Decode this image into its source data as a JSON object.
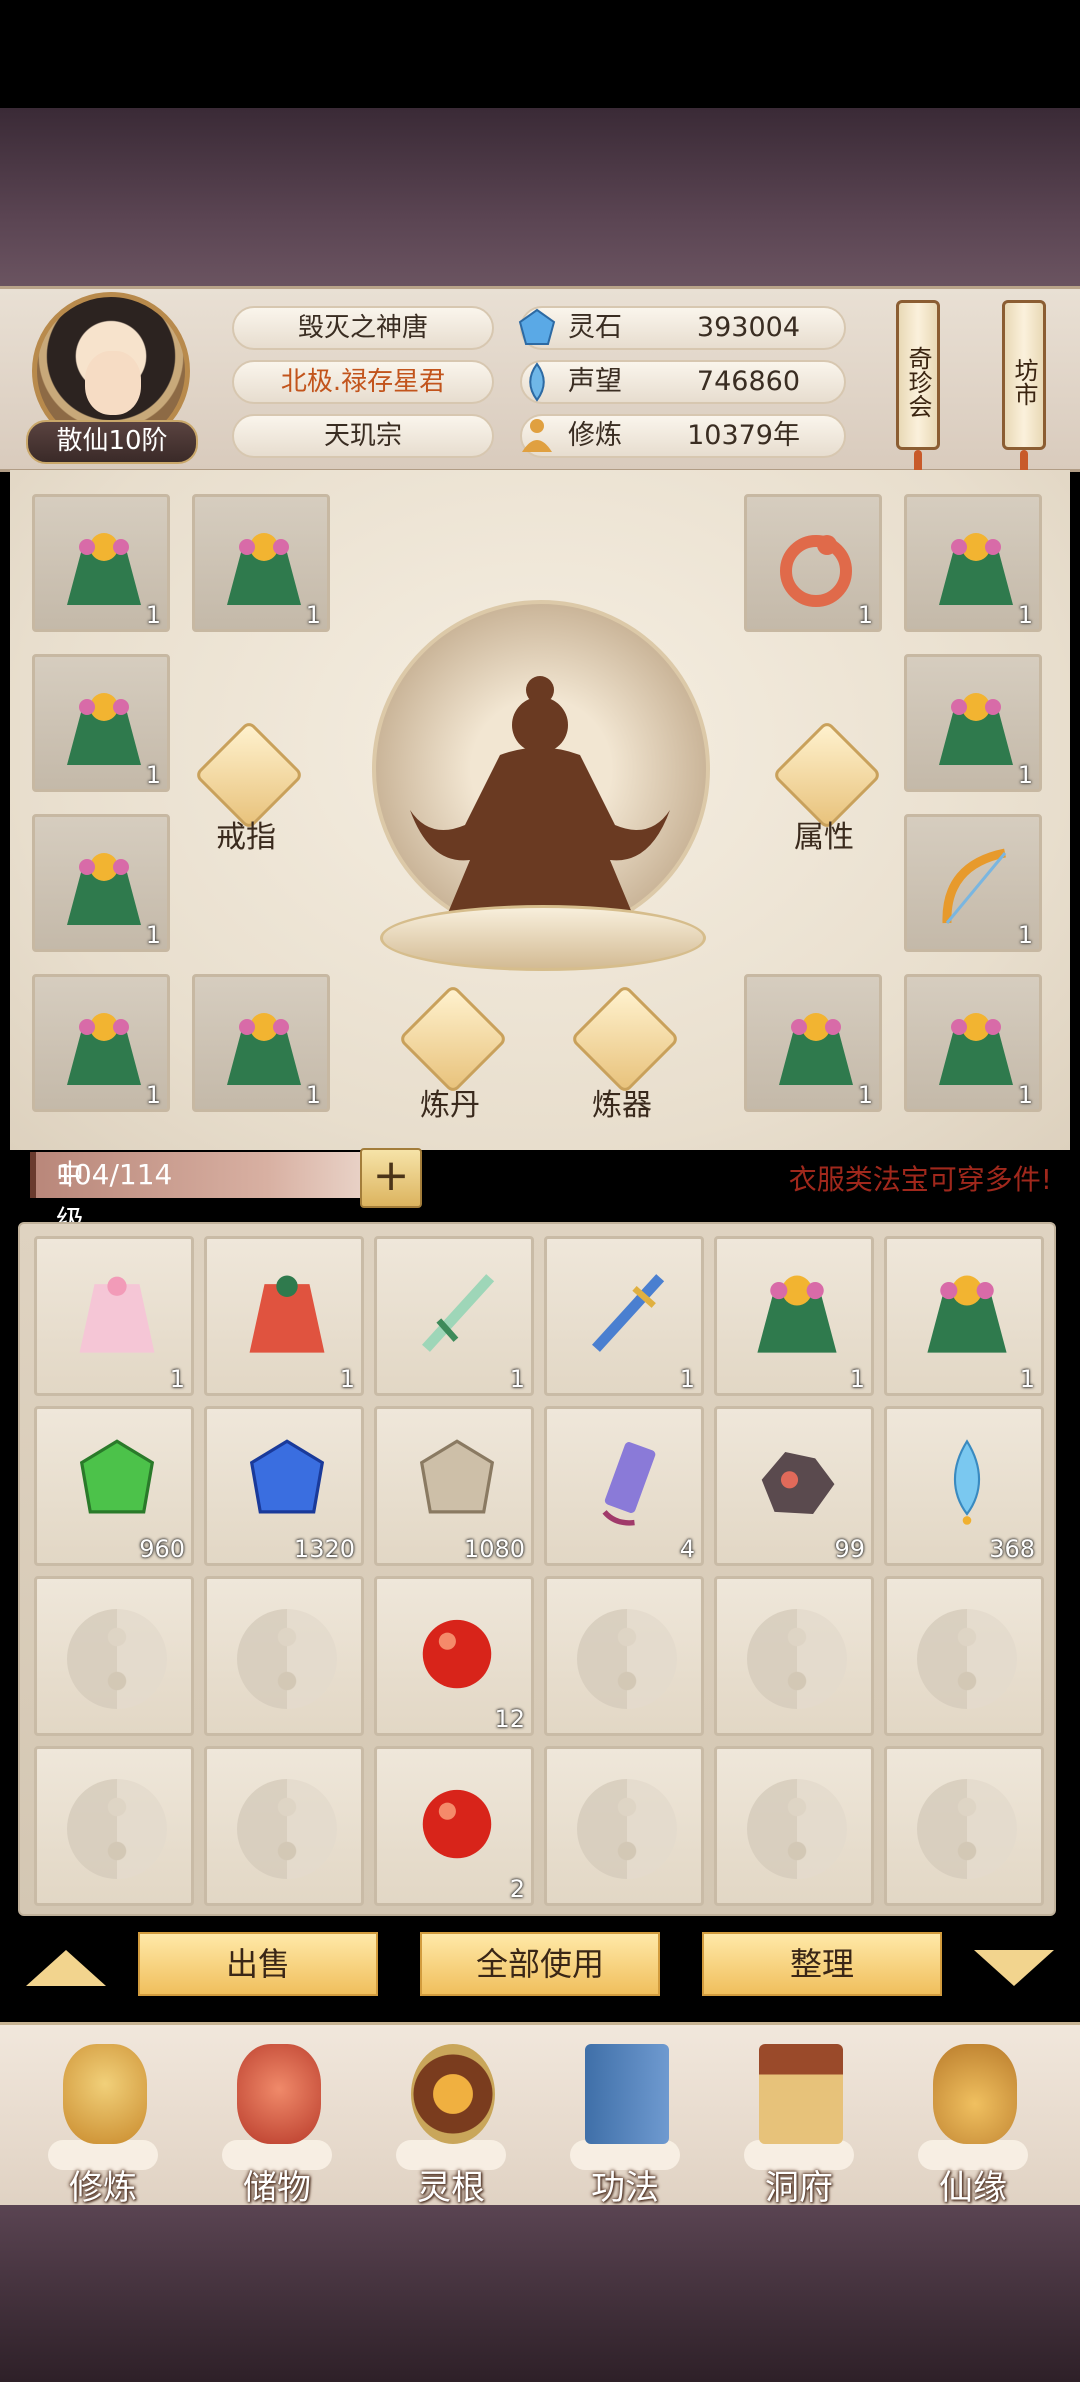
{
  "player": {
    "rank": "散仙10阶",
    "name": "毁灭之神唐",
    "title": "北极.禄存星君",
    "sect": "天玑宗"
  },
  "resources": [
    {
      "label": "灵石",
      "value": "393004",
      "icon": "spirit-stone-icon"
    },
    {
      "label": "声望",
      "value": "746860",
      "icon": "reputation-icon"
    },
    {
      "label": "修炼",
      "value": "10379年",
      "icon": "meditation-icon"
    }
  ],
  "side_buttons": {
    "treasure": "奇珍会",
    "market": "坊市"
  },
  "equip": {
    "left_slots": [
      {
        "item": "green-robe",
        "count": "1"
      },
      {
        "item": "green-robe",
        "count": "1"
      },
      {
        "item": "green-robe",
        "count": "1"
      },
      {
        "item": "green-robe",
        "count": "1"
      },
      {
        "item": "green-robe",
        "count": "1"
      },
      {
        "item": "green-robe",
        "count": "1"
      }
    ],
    "right_slots": [
      {
        "item": "dragon-ring",
        "count": "1"
      },
      {
        "item": "green-robe",
        "count": "1"
      },
      {
        "item": "green-robe",
        "count": "1"
      },
      {
        "item": "bow",
        "count": "1"
      },
      {
        "item": "green-robe",
        "count": "1"
      },
      {
        "item": "green-robe",
        "count": "1"
      }
    ],
    "ring_label": "戒指",
    "attr_label": "属性",
    "alchemy_label": "炼丹",
    "forge_label": "炼器"
  },
  "bag": {
    "name": "中级储物手镯",
    "capacity": "104/114",
    "hint": "衣服类法宝可穿多件!"
  },
  "inventory": [
    {
      "item": "pink-robe",
      "count": "1"
    },
    {
      "item": "red-robe",
      "count": "1"
    },
    {
      "item": "jade-sword",
      "count": "1"
    },
    {
      "item": "blue-sword",
      "count": "1"
    },
    {
      "item": "green-robe",
      "count": "1"
    },
    {
      "item": "green-robe",
      "count": "1"
    },
    {
      "item": "green-gem",
      "count": "960"
    },
    {
      "item": "blue-gem",
      "count": "1320"
    },
    {
      "item": "silver-gem",
      "count": "1080"
    },
    {
      "item": "talisman-banner",
      "count": "4"
    },
    {
      "item": "ore-chunk",
      "count": "99"
    },
    {
      "item": "blue-crystal",
      "count": "368"
    },
    {
      "item": "empty",
      "count": ""
    },
    {
      "item": "empty",
      "count": ""
    },
    {
      "item": "red-pill",
      "count": "12"
    },
    {
      "item": "empty",
      "count": ""
    },
    {
      "item": "empty",
      "count": ""
    },
    {
      "item": "empty",
      "count": ""
    },
    {
      "item": "empty",
      "count": ""
    },
    {
      "item": "empty",
      "count": ""
    },
    {
      "item": "red-pill",
      "count": "2"
    },
    {
      "item": "empty",
      "count": ""
    },
    {
      "item": "empty",
      "count": ""
    },
    {
      "item": "empty",
      "count": ""
    }
  ],
  "actions": {
    "sell": "出售",
    "use_all": "全部使用",
    "sort": "整理"
  },
  "nav": [
    {
      "label": "修炼",
      "icon": "cultivation-icon"
    },
    {
      "label": "储物",
      "icon": "storage-bag-icon"
    },
    {
      "label": "灵根",
      "icon": "spirit-root-icon"
    },
    {
      "label": "功法",
      "icon": "skill-book-icon"
    },
    {
      "label": "洞府",
      "icon": "cave-dwelling-icon"
    },
    {
      "label": "仙缘",
      "icon": "immortal-fate-icon"
    }
  ]
}
